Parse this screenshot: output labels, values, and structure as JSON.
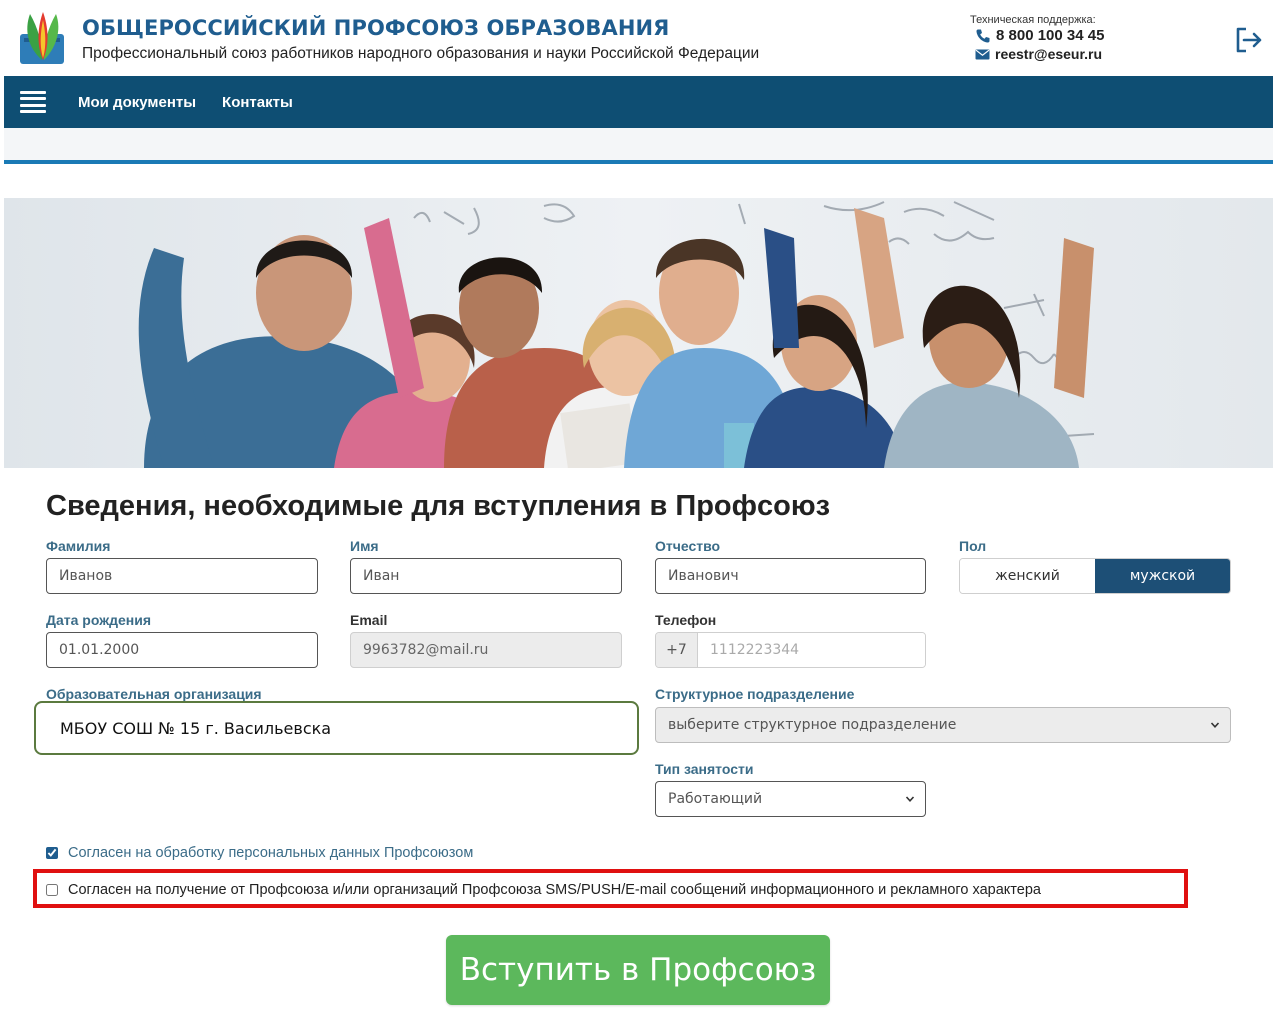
{
  "header": {
    "org_title": "ОБЩЕРОССИЙСКИЙ ПРОФСОЮЗ ОБРАЗОВАНИЯ",
    "org_subtitle": "Профессиональный союз работников народного образования и науки Российской Федерации",
    "support_label": "Техническая поддержка:",
    "support_phone": "8 800 100 34 45",
    "support_email": "reestr@eseur.ru"
  },
  "nav": {
    "items": [
      "Мои документы",
      "Контакты"
    ]
  },
  "form": {
    "title": "Сведения, необходимые для вступления в Профсоюз",
    "last_name": {
      "label": "Фамилия",
      "value": "Иванов"
    },
    "first_name": {
      "label": "Имя",
      "value": "Иван"
    },
    "patronymic": {
      "label": "Отчество",
      "value": "Иванович"
    },
    "gender": {
      "label": "Пол",
      "options": [
        "женский",
        "мужской"
      ],
      "selected": "мужской"
    },
    "birth_date": {
      "label": "Дата рождения",
      "value": "01.01.2000"
    },
    "email": {
      "label": "Email",
      "value": "9963782@mail.ru"
    },
    "phone": {
      "label": "Телефон",
      "prefix": "+7",
      "placeholder": "1112223344"
    },
    "org": {
      "label": "Образовательная организация",
      "value": "МБОУ СОШ № 15 г. Васильевска"
    },
    "division": {
      "label": "Структурное подразделение",
      "selected": "выберите структурное подразделение"
    },
    "employment": {
      "label": "Тип занятости",
      "selected": "Работающий"
    },
    "consent_personal": {
      "label": "Согласен на обработку персональных данных Профсоюзом",
      "checked": true
    },
    "consent_messages": {
      "label": "Согласен на получение от Профсоюза и/или организаций Профсоюза SMS/PUSH/E-mail сообщений информационного и рекламного характера",
      "checked": false
    },
    "submit_label": "Вступить в Профсоюз"
  },
  "colors": {
    "brand": "#1f5d8f",
    "nav_bg": "#0e4e73",
    "label": "#3b6c88",
    "submit": "#5cb85c",
    "highlight": "#e01010",
    "org_border": "#5b7a3f"
  }
}
